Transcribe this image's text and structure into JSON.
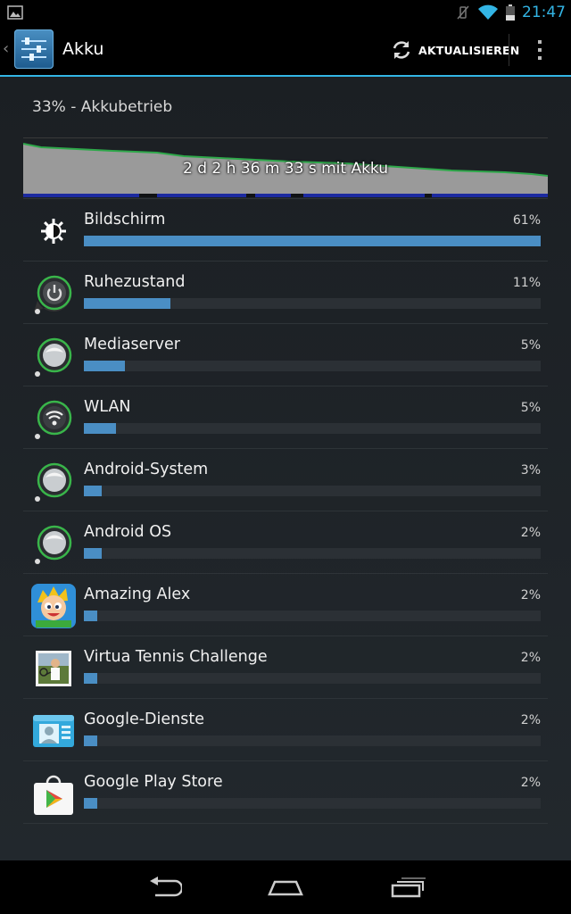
{
  "status_bar": {
    "time": "21:47",
    "icons": [
      "gallery-notification-icon",
      "vibrate-muted-icon",
      "wifi-icon",
      "battery-icon"
    ]
  },
  "action_bar": {
    "title": "Akku",
    "refresh_label": "AKTUALISIEREN",
    "icons": [
      "settings-app-icon",
      "refresh-icon",
      "overflow-menu-icon"
    ]
  },
  "battery": {
    "summary": "33% - Akkubetrieb",
    "graph_label": "2 d 2 h 36 m 33 s mit Akku",
    "colors": {
      "graph_fill": "#9a9a9a",
      "graph_line": "#2ea84a",
      "graph_base": "#1c2aa0"
    }
  },
  "usage": [
    {
      "name": "Bildschirm",
      "percent_label": "61%",
      "fraction": 1.0,
      "icon": "brightness-icon"
    },
    {
      "name": "Ruhezustand",
      "percent_label": "11%",
      "fraction": 0.19,
      "icon": "power-icon"
    },
    {
      "name": "Mediaserver",
      "percent_label": "5%",
      "fraction": 0.09,
      "icon": "android-system-icon"
    },
    {
      "name": "WLAN",
      "percent_label": "5%",
      "fraction": 0.07,
      "icon": "wifi-icon"
    },
    {
      "name": "Android-System",
      "percent_label": "3%",
      "fraction": 0.04,
      "icon": "android-system-icon"
    },
    {
      "name": "Android OS",
      "percent_label": "2%",
      "fraction": 0.04,
      "icon": "android-system-icon"
    },
    {
      "name": "Amazing Alex",
      "percent_label": "2%",
      "fraction": 0.03,
      "icon": "amazing-alex-app-icon"
    },
    {
      "name": "Virtua Tennis Challenge",
      "percent_label": "2%",
      "fraction": 0.03,
      "icon": "virtua-tennis-app-icon"
    },
    {
      "name": "Google-Dienste",
      "percent_label": "2%",
      "fraction": 0.03,
      "icon": "google-services-app-icon"
    },
    {
      "name": "Google Play Store",
      "percent_label": "2%",
      "fraction": 0.03,
      "icon": "play-store-app-icon"
    }
  ],
  "nav_bar": {
    "icons": [
      "back-icon",
      "home-icon",
      "recent-apps-icon"
    ]
  }
}
